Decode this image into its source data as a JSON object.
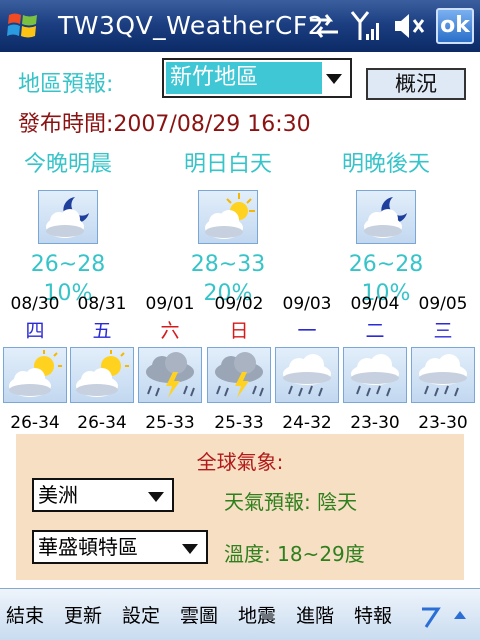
{
  "titlebar": {
    "title": "TW3QV_WeatherCF2",
    "ok_label": "ok"
  },
  "area": {
    "label": "地區預報:",
    "selected": "新竹地區",
    "overview_button": "概況"
  },
  "publish": {
    "label": "發布時間:",
    "time": "2007/08/29 16:30"
  },
  "periods": [
    {
      "label": "今晚明晨",
      "icon": "partly-cloudy-night-icon",
      "temp": "26~28",
      "rain": "10%"
    },
    {
      "label": "明日白天",
      "icon": "partly-cloudy-day-icon",
      "temp": "28~33",
      "rain": "20%"
    },
    {
      "label": "明晚後天",
      "icon": "partly-cloudy-night-icon",
      "temp": "26~28",
      "rain": "10%"
    }
  ],
  "week": [
    {
      "date": "08/30",
      "day": "四",
      "day_color": "#2a2ad6",
      "icon": "sun-cloud-icon",
      "temp": "26-34"
    },
    {
      "date": "08/31",
      "day": "五",
      "day_color": "#2a2ad6",
      "icon": "sun-cloud-icon",
      "temp": "26-34"
    },
    {
      "date": "09/01",
      "day": "六",
      "day_color": "#d61a1a",
      "icon": "thunderstorm-icon",
      "temp": "25-33"
    },
    {
      "date": "09/02",
      "day": "日",
      "day_color": "#d61a1a",
      "icon": "thunderstorm-icon",
      "temp": "25-33"
    },
    {
      "date": "09/03",
      "day": "一",
      "day_color": "#2a2ad6",
      "icon": "rain-icon",
      "temp": "24-32"
    },
    {
      "date": "09/04",
      "day": "二",
      "day_color": "#2a2ad6",
      "icon": "rain-icon",
      "temp": "23-30"
    },
    {
      "date": "09/05",
      "day": "三",
      "day_color": "#2a2ad6",
      "icon": "rain-icon",
      "temp": "23-30"
    }
  ],
  "global": {
    "title": "全球氣象:",
    "region": "美洲",
    "city": "華盛頓特區",
    "forecast_label": "天氣預報:",
    "forecast_value": "陰天",
    "temp_label": "溫度:",
    "temp_value": "18~29度"
  },
  "menu": {
    "items": [
      "結束",
      "更新",
      "設定",
      "雲圖",
      "地震",
      "進階",
      "特報"
    ]
  }
}
